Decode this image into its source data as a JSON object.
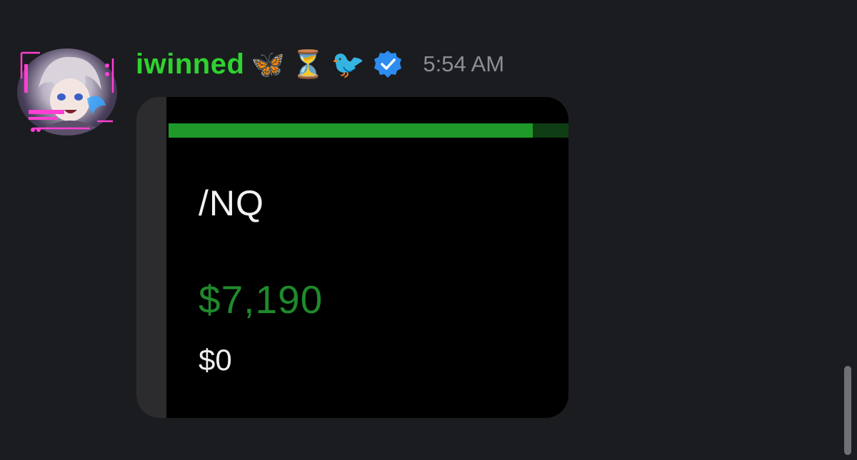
{
  "message": {
    "username": "iwinned",
    "timestamp": "5:54 AM",
    "badges": [
      {
        "name": "butterfly-icon",
        "glyph": "🦋"
      },
      {
        "name": "hourglass-icon",
        "glyph": "⏳"
      },
      {
        "name": "bird-icon",
        "glyph": "🐦"
      },
      {
        "name": "verified-badge-icon",
        "color": "#2d8cf0"
      }
    ],
    "username_color": "#2fd32f"
  },
  "attachment": {
    "symbol": "/NQ",
    "pnl_value": "$7,190",
    "second_value": "$0",
    "accent_color": "#1f9a2a"
  }
}
